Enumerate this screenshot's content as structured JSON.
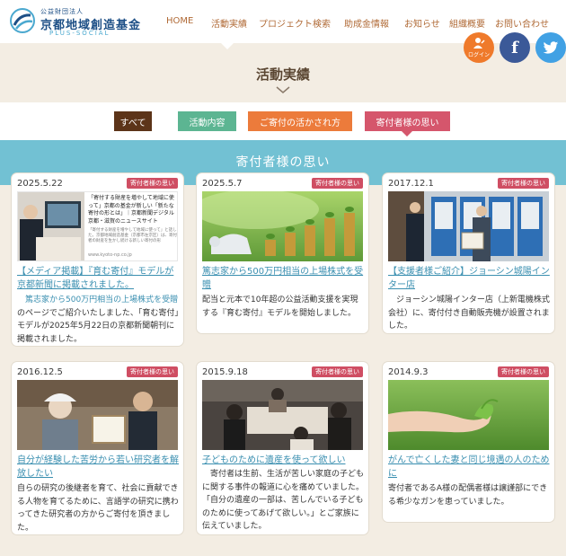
{
  "header": {
    "logo": {
      "sub": "公益財団法人",
      "main": "京都地域創造基金",
      "en": "PLUS-SOCIAL"
    },
    "nav": [
      {
        "label": "HOME"
      },
      {
        "label": "活動実績"
      },
      {
        "label": "プロジェクト検索"
      },
      {
        "label": "助成金情報"
      },
      {
        "label": "お知らせ"
      },
      {
        "label": "組織概要"
      },
      {
        "label": "お問い合わせ"
      }
    ],
    "login_label": "ログイン",
    "facebook_glyph": "f"
  },
  "page": {
    "title": "活動実績"
  },
  "tabs": [
    {
      "label": "すべて",
      "color": "#5c3419"
    },
    {
      "label": "活動内容",
      "color": "#5cb592"
    },
    {
      "label": "ご寄付の活かされ方",
      "color": "#ec7b3b"
    },
    {
      "label": "寄付者様の思い",
      "color": "#d5566c"
    }
  ],
  "section": {
    "title": "寄付者様の思い"
  },
  "cards": [
    {
      "date": "2025.5.22",
      "badge": "寄付者様の思い",
      "title": "【メディア掲載】『育む寄付』モデルが京都新聞に掲載されました。",
      "body_link": "篤志家から500万円相当の上場株式を受贈",
      "body": "のページでご紹介いたしました、「育む寄付」モデルが2025年5月22日の京都新聞朝刊に掲載されました。",
      "thumb": {
        "article_title": "「寄付する財産を増やして地域に使って」京都の基金が新しい「新たな寄付の形とは」｜京都新聞デジタル 京都・滋賀のニュースサイト",
        "article_text": "「寄付する財産を増やして地域に使って」と話した。京都地域創造基金（京都市左京区）は、寄付者の財産を生かし続ける新しい寄付の形",
        "article_url": "www.kyoto-np.co.jp"
      }
    },
    {
      "date": "2025.5.7",
      "badge": "寄付者様の思い",
      "title": "篤志家から500万円相当の上場株式を受贈",
      "body": "配当と元本で10年超の公益活動支援を実現する『育む寄付』モデルを開始しました。"
    },
    {
      "date": "2017.12.1",
      "badge": "寄付者様の思い",
      "title": "【支援者様ご紹介】ジョーシン城陽インター店",
      "body": "ジョーシン城陽インター店（上新電機株式会社）に、寄付付き自動販売機が設置されました。"
    },
    {
      "date": "2016.12.5",
      "badge": "寄付者様の思い",
      "title": "自分が経験した苦労から若い研究者を解放したい",
      "body": "自らの研究の後継者を育て、社会に貢献できる人物を育てるために、言語学の研究に携わってきた研究者の方からご寄付を頂きました。"
    },
    {
      "date": "2015.9.18",
      "badge": "寄付者様の思い",
      "title": "子どものために遺産を使って欲しい",
      "body": "寄付者は生前、生活が苦しい家庭の子どもに関する事件の報道に心を痛めていました。「自分の遺産の一部は、苦しんでいる子どものために使ってあげて欲しい。」とご家族に伝えていました。"
    },
    {
      "date": "2014.9.3",
      "badge": "寄付者様の思い",
      "title": "がんで亡くした妻と同じ境遇の人のために",
      "body": "寄付者であるA様の配偶者様は譲謹部にできる希少なガンを患っていました。"
    }
  ]
}
